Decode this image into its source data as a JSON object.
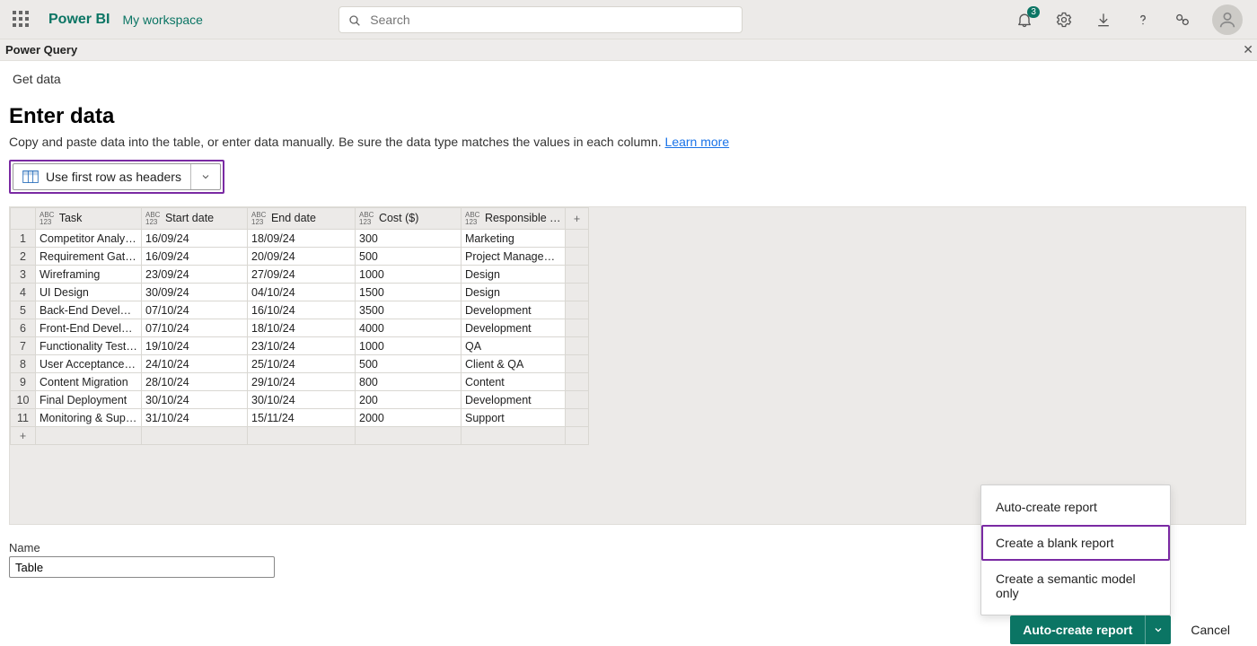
{
  "header": {
    "brand": "Power BI",
    "workspace": "My workspace",
    "search_placeholder": "Search",
    "notification_count": "3"
  },
  "secondary": {
    "title": "Power Query"
  },
  "page": {
    "getdata": "Get data",
    "title": "Enter data",
    "subtext_prefix": "Copy and paste data into the table, or enter data manually. Be sure the data type matches the values in each column. ",
    "learn_more": "Learn more",
    "headers_button": "Use first row as headers",
    "name_label": "Name",
    "name_value": "Table"
  },
  "grid": {
    "columns": [
      "Task",
      "Start date",
      "End date",
      "Cost ($)",
      "Responsible Te..."
    ],
    "rows": [
      {
        "n": "1",
        "cells": [
          "Competitor Analysis",
          "16/09/24",
          "18/09/24",
          "300",
          "Marketing"
        ]
      },
      {
        "n": "2",
        "cells": [
          "Requirement Gathe...",
          "16/09/24",
          "20/09/24",
          "500",
          "Project Management"
        ]
      },
      {
        "n": "3",
        "cells": [
          "Wireframing",
          "23/09/24",
          "27/09/24",
          "1000",
          "Design"
        ]
      },
      {
        "n": "4",
        "cells": [
          "UI Design",
          "30/09/24",
          "04/10/24",
          "1500",
          "Design"
        ]
      },
      {
        "n": "5",
        "cells": [
          "Back-End Develop...",
          "07/10/24",
          "16/10/24",
          "3500",
          "Development"
        ]
      },
      {
        "n": "6",
        "cells": [
          "Front-End Develop...",
          "07/10/24",
          "18/10/24",
          "4000",
          "Development"
        ]
      },
      {
        "n": "7",
        "cells": [
          "Functionality Testing",
          "19/10/24",
          "23/10/24",
          "1000",
          "QA"
        ]
      },
      {
        "n": "8",
        "cells": [
          "User Acceptance T...",
          "24/10/24",
          "25/10/24",
          "500",
          "Client & QA"
        ]
      },
      {
        "n": "9",
        "cells": [
          "Content Migration",
          "28/10/24",
          "29/10/24",
          "800",
          "Content"
        ]
      },
      {
        "n": "10",
        "cells": [
          "Final Deployment",
          "30/10/24",
          "30/10/24",
          "200",
          "Development"
        ]
      },
      {
        "n": "11",
        "cells": [
          "Monitoring & Support",
          "31/10/24",
          "15/11/24",
          "2000",
          "Support"
        ]
      }
    ],
    "add_row": "+",
    "add_col": "+"
  },
  "popup": {
    "items": [
      "Auto-create report",
      "Create a blank report",
      "Create a semantic model only"
    ],
    "highlight_index": 1
  },
  "footer": {
    "primary": "Auto-create report",
    "cancel": "Cancel"
  }
}
